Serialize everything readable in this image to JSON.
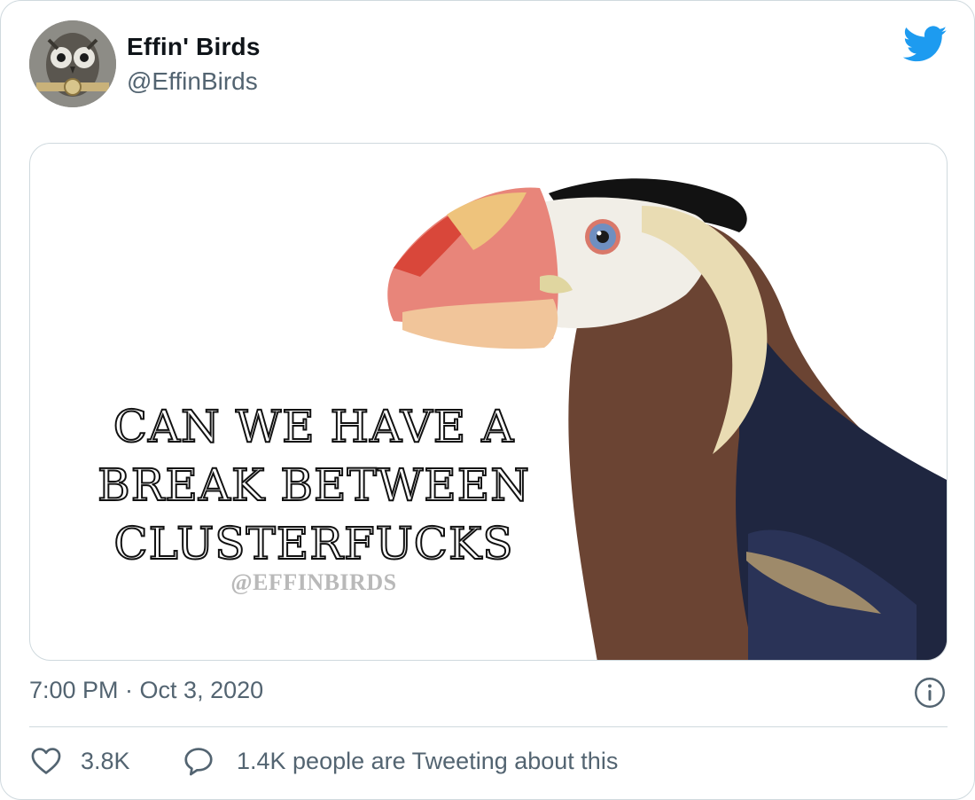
{
  "tweet": {
    "author": {
      "display_name": "Effin' Birds",
      "handle": "@EffinBirds"
    },
    "media": {
      "caption_lines": [
        "CAN WE HAVE A",
        "BREAK BETWEEN",
        "CLUSTERFUCKS"
      ],
      "watermark": "@EFFINBIRDS"
    },
    "timestamp": "7:00 PM · Oct 3, 2020",
    "likes": "3.8K",
    "reply_text": "1.4K people are Tweeting about this"
  },
  "icons": {
    "logo": "twitter-bird-icon",
    "info": "info-icon",
    "like": "heart-icon",
    "reply": "speech-bubble-icon"
  },
  "colors": {
    "brand": "#1d9bf0",
    "secondary_text": "#536471",
    "border": "#cfd9de"
  }
}
